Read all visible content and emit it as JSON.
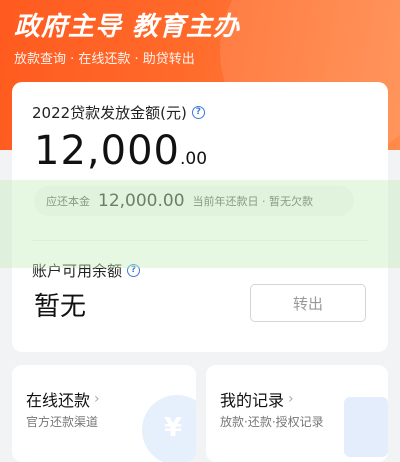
{
  "hero": {
    "title": "政府主导 教育主办",
    "subtitle": "放款查询 · 在线还款 · 助贷转出"
  },
  "loan": {
    "label": "2022贷款发放金额(元)",
    "amount_int": "12,000",
    "amount_dec": ".00",
    "pill_prefix": "应还本金",
    "pill_amount": "12,000.00",
    "pill_suffix": "当前年还款日 · 暂无欠款"
  },
  "available": {
    "label": "账户可用余额",
    "value": "暂无",
    "transfer_label": "转出"
  },
  "cards": {
    "repay_title": "在线还款",
    "repay_sub": "官方还款渠道",
    "records_title": "我的记录",
    "records_sub": "放款·还款·授权记录"
  },
  "colors": {
    "brand": "#ff5a1f",
    "accent_blue": "#3b7bdc"
  },
  "icons": {
    "help": "question-circle-icon",
    "chevron": "chevron-right-icon"
  }
}
